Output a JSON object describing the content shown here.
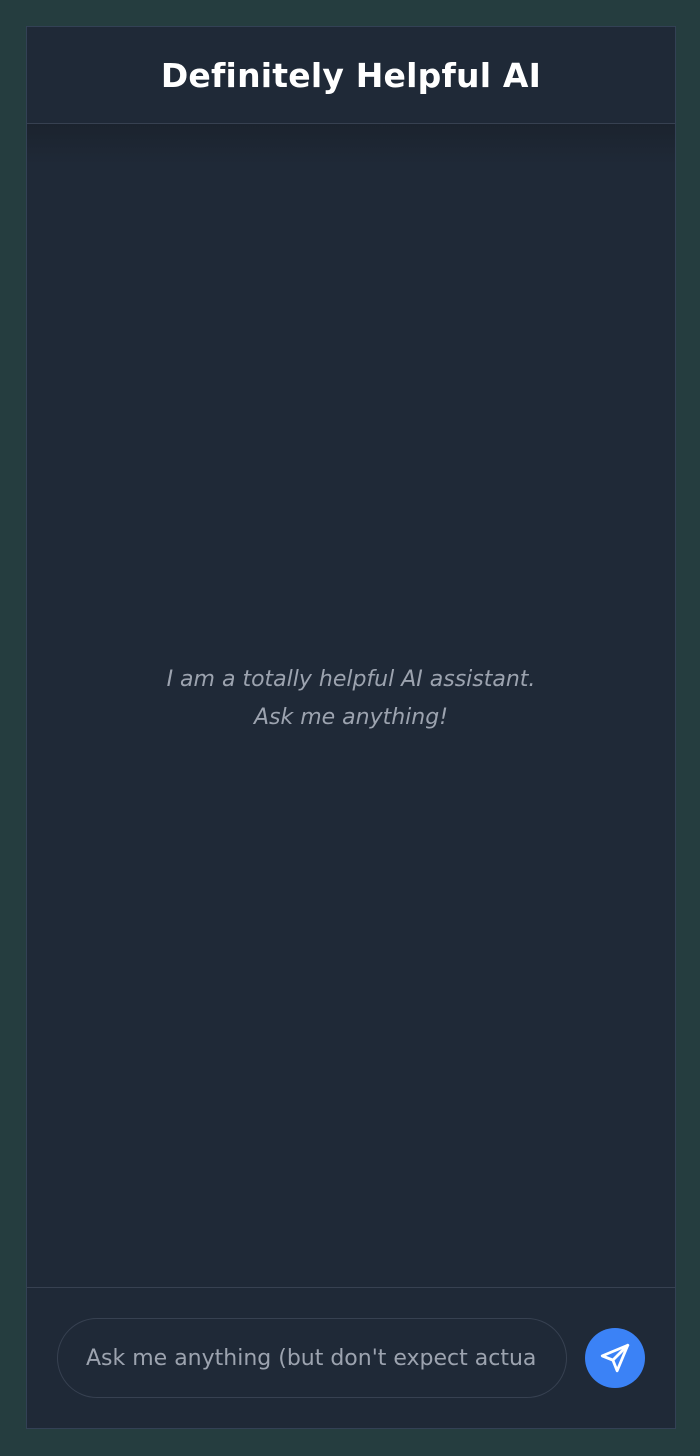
{
  "header": {
    "title": "Definitely Helpful AI"
  },
  "chat": {
    "empty_state": [
      "I am a totally helpful AI assistant.",
      "Ask me anything!"
    ]
  },
  "composer": {
    "placeholder": "Ask me anything (but don't expect actual help)",
    "value": "",
    "send_icon": "send-icon"
  },
  "colors": {
    "page_background": "#253d3f",
    "panel_background": "#1f2937",
    "accent": "#3b82f6",
    "muted_text": "#9ca3af",
    "title_text": "#ffffff"
  }
}
